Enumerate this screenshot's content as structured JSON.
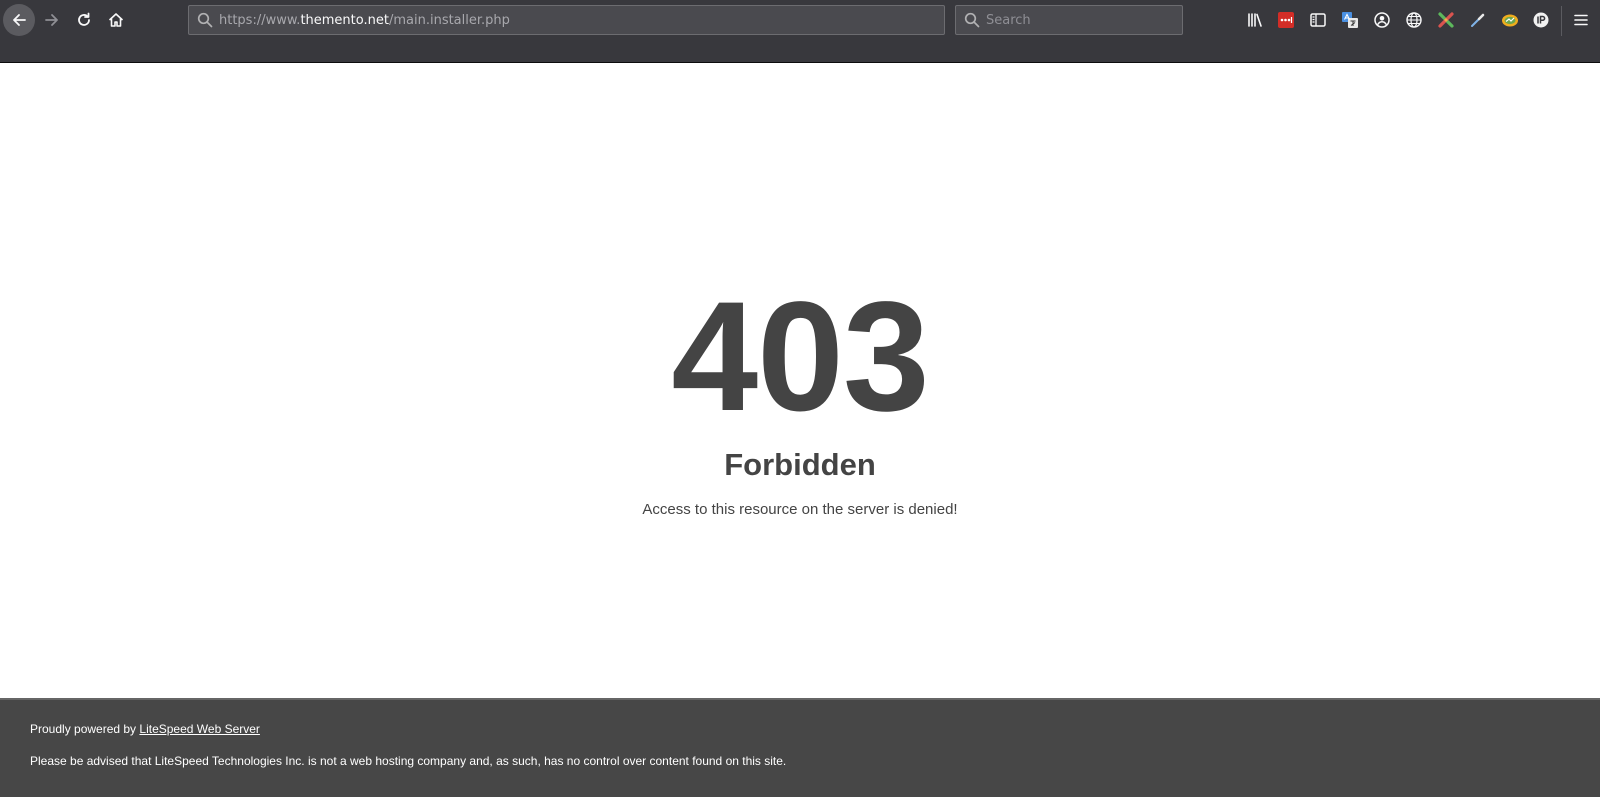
{
  "browser": {
    "url": {
      "prefix": "https://www.",
      "host": "themento.net",
      "path": "/main.installer.php"
    },
    "search": {
      "placeholder": "Search"
    },
    "icons": {
      "back": "back-arrow-icon",
      "forward": "forward-arrow-icon",
      "reload": "reload-icon",
      "home": "home-icon",
      "library": "library-icon",
      "extensions": [
        "lastpass-icon",
        "sidebar-icon",
        "translate-icon",
        "account-icon",
        "globe-icon",
        "color-picker-icon",
        "eyedropper-icon",
        "seo-quake-icon",
        "ip-icon"
      ],
      "menu": "hamburger-menu-icon"
    },
    "colors": {
      "chrome": "#38383d",
      "field": "#4a4a4f",
      "lastpass_red": "#d32d27"
    }
  },
  "error": {
    "code": "403",
    "title": "Forbidden",
    "message": "Access to this resource on the server is denied!"
  },
  "footer": {
    "powered_prefix": "Proudly powered by ",
    "powered_link": "LiteSpeed Web Server",
    "disclaimer": "Please be advised that LiteSpeed Technologies Inc. is not a web hosting company and, as such, has no control over content found on this site."
  },
  "colors": {
    "text": "#444444",
    "footer_bg": "#474747"
  }
}
